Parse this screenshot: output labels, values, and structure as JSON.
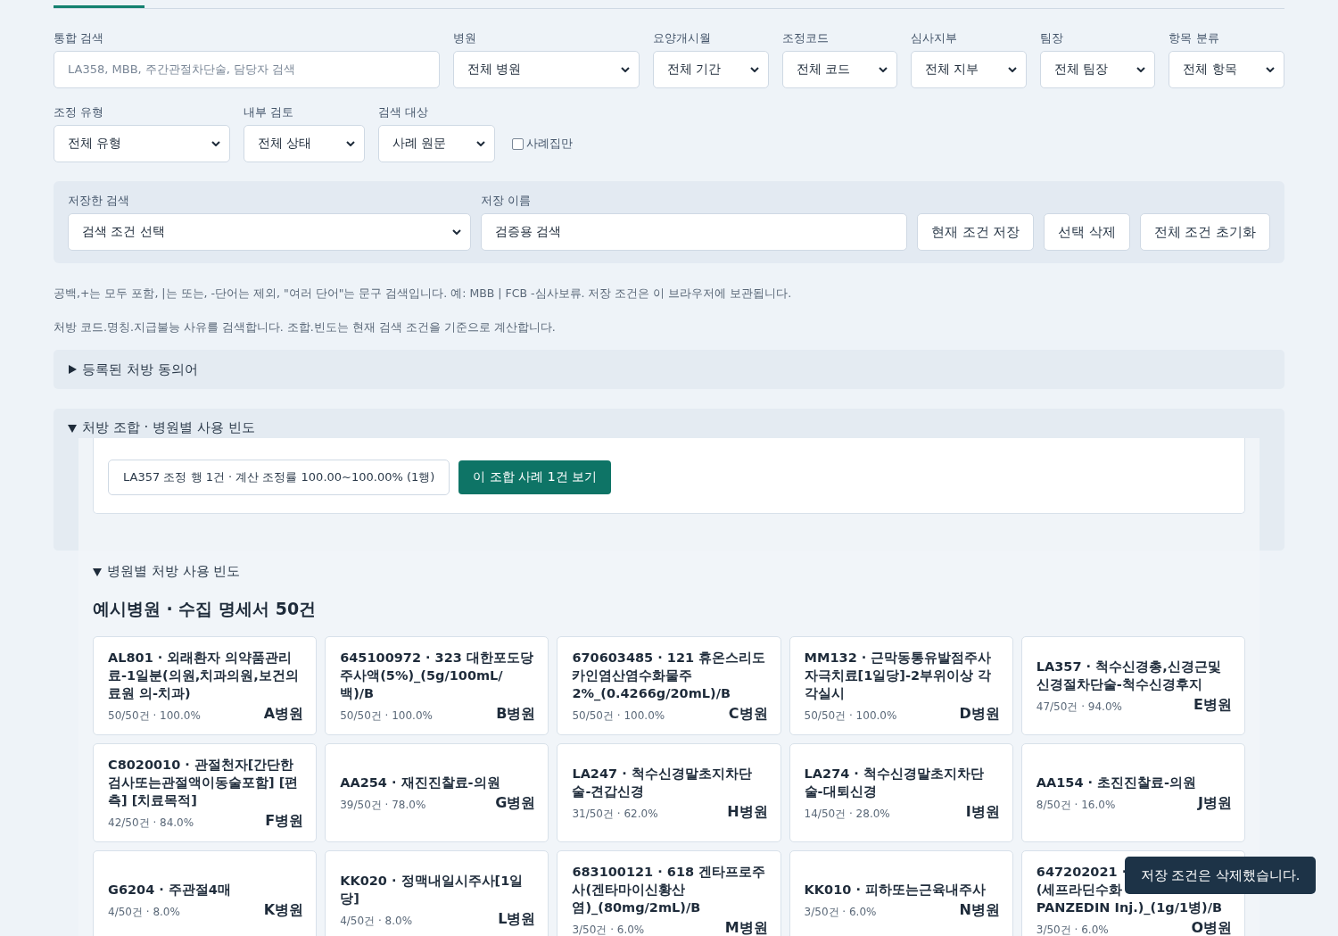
{
  "tabs": [
    {
      "selected": true
    }
  ],
  "filters": [
    {
      "label": "통합 검색",
      "kind": "text",
      "placeholder": "LA358, MBB, 주간관절차단술, 담당자 검색"
    },
    {
      "label": "병원",
      "kind": "select",
      "value": "전체 병원"
    },
    {
      "label": "요양개시월",
      "kind": "select",
      "value": "전체 기간"
    },
    {
      "label": "조정코드",
      "kind": "select",
      "value": "전체 코드"
    },
    {
      "label": "심사지부",
      "kind": "select",
      "value": "전체 지부"
    },
    {
      "label": "팀장",
      "kind": "select",
      "value": "전체 팀장"
    },
    {
      "label": "항목 분류",
      "kind": "select",
      "value": "전체 항목"
    }
  ],
  "filters2": [
    {
      "label": "조정 유형",
      "kind": "select",
      "value": "전체 유형"
    },
    {
      "label": "내부 검토",
      "kind": "select",
      "value": "전체 상태"
    },
    {
      "label": "검색 대상",
      "kind": "select",
      "value": "사례 원문"
    }
  ],
  "casebook_only": {
    "label": "사례집만",
    "checked": false
  },
  "saved_search": {
    "label": "저장한 검색",
    "value": "검색 조건 선택",
    "name_label": "저장 이름",
    "name_value": "검증용 검색",
    "buttons": [
      "현재 조건 저장",
      "선택 삭제",
      "전체 조건 초기화"
    ]
  },
  "help": [
    "공백,+는 모두 포함, |는 또는, -단어는 제외, \"여러 단어\"는 문구 검색입니다. 예: MBB | FCB -심사보류. 저장 조건은 이 브라우저에 보관됩니다.",
    "처방 코드.명칭.지급불능 사유를 검색합니다. 조합.빈도는 현재 검색 조건을 기준으로 계산합니다."
  ],
  "synonyms": {
    "title": "등록된 처방 동의어",
    "expanded": false
  },
  "combination": {
    "title": "처방 조합 · 병원별 사용 빈도",
    "expanded": true,
    "summary": "LA357 조정 행 1건 · 계산 조정률 100.00~100.00% (1행)",
    "button": "이 조합 사례 1건 보기"
  },
  "frequency": {
    "title": "병원별 처방 사용 빈도",
    "expanded": true,
    "heading": "예시병원 · 수집 명세서 50건",
    "cards": [
      {
        "title": "AL801 · 외래환자 의약품관리료-1일분(의원,치과의원,보건의료원 의-치과)",
        "meta": "50/50건 · 100.0%",
        "hospital": "A병원"
      },
      {
        "title": "645100972 · 323 대한포도당주사액(5%)_(5g/100mL/백)/B",
        "meta": "50/50건 · 100.0%",
        "hospital": "B병원"
      },
      {
        "title": "670603485 · 121 휴온스리도카인염산염수화물주2%_(0.4266g/20mL)/B",
        "meta": "50/50건 · 100.0%",
        "hospital": "C병원"
      },
      {
        "title": "MM132 · 근막동통유발점주사자극치료[1일당]-2부위이상 각각실시",
        "meta": "50/50건 · 100.0%",
        "hospital": "D병원"
      },
      {
        "title": "LA357 · 척수신경총,신경근및신경절차단술-척수신경후지",
        "meta": "47/50건 · 94.0%",
        "hospital": "E병원"
      },
      {
        "title": "C8020010 · 관절천자[간단한검사또는관절액이동술포함] [편측] [치료목적]",
        "meta": "42/50건 · 84.0%",
        "hospital": "F병원"
      },
      {
        "title": "AA254 · 재진진찰료-의원",
        "meta": "39/50건 · 78.0%",
        "hospital": "G병원"
      },
      {
        "title": "LA247 · 척수신경말초지차단술-견갑신경",
        "meta": "31/50건 · 62.0%",
        "hospital": "H병원"
      },
      {
        "title": "LA274 · 척수신경말초지차단술-대퇴신경",
        "meta": "14/50건 · 28.0%",
        "hospital": "I병원"
      },
      {
        "title": "AA154 · 초진진찰료-의원",
        "meta": "8/50건 · 16.0%",
        "hospital": "J병원"
      },
      {
        "title": "G6204 · 주관절4매",
        "meta": "4/50건 · 8.0%",
        "hospital": "K병원"
      },
      {
        "title": "KK020 · 정맥내일시주사[1일당]",
        "meta": "4/50건 · 8.0%",
        "hospital": "L병원"
      },
      {
        "title": "683100121 · 618 겐타프로주사(겐타마이신황산염)_(80mg/2mL)/B",
        "meta": "3/50건 · 6.0%",
        "hospital": "M병원"
      },
      {
        "title": "KK010 · 피하또는근육내주사",
        "meta": "3/50건 · 6.0%",
        "hospital": "N병원"
      },
      {
        "title_lines": [
          "647202021 ·",
          "(세프라딘수화",
          "PANZEDIN Inj.)_(1g/1병)/B"
        ],
        "meta": "3/50건 · 6.0%",
        "hospital": "O병원"
      }
    ]
  },
  "toast": "저장 조건은 삭제했습니다."
}
